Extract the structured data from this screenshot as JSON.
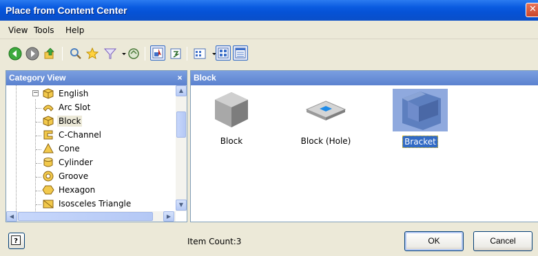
{
  "window": {
    "title": "Place from Content Center",
    "close_glyph": "✕"
  },
  "menu": {
    "items": [
      "View",
      "Tools",
      "Help"
    ]
  },
  "toolbar": {
    "icons": [
      "back-icon",
      "forward-icon",
      "up-folder-icon",
      "search-icon",
      "favorites-icon",
      "filter-icon",
      "dropdown-arrow-icon",
      "refresh-icon",
      "select-mode-icon",
      "update-icon",
      "view-options-icon",
      "dropdown-arrow-icon",
      "list-view-icon",
      "details-view-icon"
    ]
  },
  "category_view": {
    "title": "Category View",
    "close_glyph": "×",
    "root": {
      "label": "English",
      "expander": "−"
    },
    "items": [
      {
        "label": "Arc Slot",
        "icon": "arc-slot-icon",
        "selected": false
      },
      {
        "label": "Block",
        "icon": "block-icon",
        "selected": true
      },
      {
        "label": "C-Channel",
        "icon": "c-channel-icon",
        "selected": false
      },
      {
        "label": "Cone",
        "icon": "cone-icon",
        "selected": false
      },
      {
        "label": "Cylinder",
        "icon": "cylinder-icon",
        "selected": false
      },
      {
        "label": "Groove",
        "icon": "groove-icon",
        "selected": false
      },
      {
        "label": "Hexagon",
        "icon": "hexagon-icon",
        "selected": false
      },
      {
        "label": "Isosceles Triangle",
        "icon": "isosceles-triangle-icon",
        "selected": false
      }
    ]
  },
  "content_view": {
    "title": "Block",
    "items": [
      {
        "label": "Block",
        "icon": "block-shape-icon",
        "selected": false
      },
      {
        "label": "Block (Hole)",
        "icon": "block-hole-icon",
        "selected": false
      },
      {
        "label": "Bracket",
        "icon": "bracket-icon",
        "selected": true
      }
    ]
  },
  "footer": {
    "help_glyph": "?",
    "item_count": "Item Count:3",
    "ok_label": "OK",
    "cancel_label": "Cancel"
  },
  "colors": {
    "titlebar": "#0A5BE0",
    "selection": "#316AC5",
    "panel_header": "#6A90D8",
    "face": "#ECE9D8"
  }
}
